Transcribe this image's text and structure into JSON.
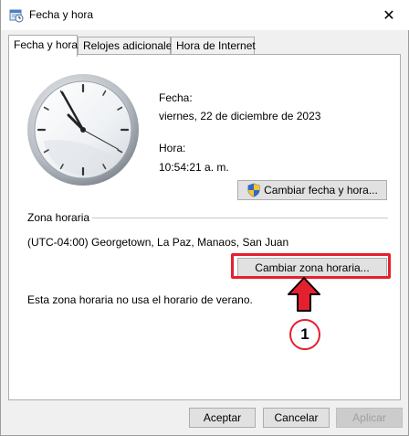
{
  "window": {
    "title": "Fecha y hora",
    "close_glyph": "✕"
  },
  "tabs": [
    {
      "label": "Fecha y hora",
      "active": true
    },
    {
      "label": "Relojes adicionales",
      "active": false
    },
    {
      "label": "Hora de Internet",
      "active": false
    }
  ],
  "date_time": {
    "date_label": "Fecha:",
    "date_value": "viernes, 22 de diciembre de 2023",
    "time_label": "Hora:",
    "time_value": "10:54:21 a. m.",
    "change_button": "Cambiar fecha y hora..."
  },
  "timezone": {
    "section_label": "Zona horaria",
    "current": "(UTC-04:00) Georgetown, La Paz, Manaos, San Juan",
    "change_button": "Cambiar zona horaria...",
    "dst_note": "Esta zona horaria no usa el horario de verano."
  },
  "footer": {
    "ok": "Aceptar",
    "cancel": "Cancelar",
    "apply": "Aplicar"
  },
  "annotation": {
    "step_number": "1",
    "color": "#e5202e"
  },
  "icons": {
    "title": "calendar-clock-icon",
    "clock": "analog-clock-icon",
    "shield": "uac-shield-icon",
    "arrow": "arrow-up-icon"
  }
}
